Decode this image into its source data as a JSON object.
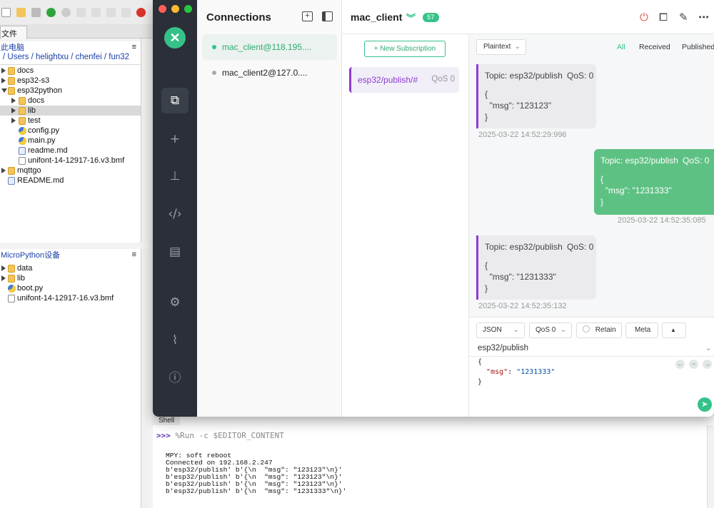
{
  "thonny": {
    "files_tab": "文件",
    "local": {
      "header": "此电脑",
      "menu_icon": "≡",
      "path": "/ Users / helightxu / chenfei / fun32",
      "items": [
        {
          "label": "docs",
          "type": "folder",
          "depth": 0,
          "arrow": "closed"
        },
        {
          "label": "esp32-s3",
          "type": "folder",
          "depth": 0,
          "arrow": "closed"
        },
        {
          "label": "esp32python",
          "type": "folder",
          "depth": 0,
          "arrow": "open"
        },
        {
          "label": "docs",
          "type": "folder",
          "depth": 1,
          "arrow": "closed"
        },
        {
          "label": "lib",
          "type": "folder",
          "depth": 1,
          "arrow": "closed",
          "selected": true
        },
        {
          "label": "test",
          "type": "folder",
          "depth": 1,
          "arrow": "closed"
        },
        {
          "label": "config.py",
          "type": "py",
          "depth": 1
        },
        {
          "label": "main.py",
          "type": "py",
          "depth": 1
        },
        {
          "label": "readme.md",
          "type": "doc",
          "depth": 1
        },
        {
          "label": "unifont-14-12917-16.v3.bmf",
          "type": "file",
          "depth": 1
        },
        {
          "label": "mqttgo",
          "type": "folder",
          "depth": 0,
          "arrow": "closed"
        },
        {
          "label": "README.md",
          "type": "doc",
          "depth": 0
        }
      ]
    },
    "device": {
      "header": "MicroPython设备",
      "menu_icon": "≡",
      "items": [
        {
          "label": "data",
          "type": "folder",
          "arrow": "closed"
        },
        {
          "label": "lib",
          "type": "folder",
          "arrow": "closed"
        },
        {
          "label": "boot.py",
          "type": "py"
        },
        {
          "label": "unifont-14-12917-16.v3.bmf",
          "type": "file"
        }
      ]
    },
    "shell": {
      "tab": "Shell",
      "prompt": ">>>",
      "command": "%Run -c $EDITOR_CONTENT",
      "output": "MPY: soft reboot\nConnected on 192.168.2.247\nb'esp32/publish' b'{\\n  \"msg\": \"123123\"\\n}'\nb'esp32/publish' b'{\\n  \"msg\": \"123123\"\\n}'\nb'esp32/publish' b'{\\n  \"msg\": \"123123\"\\n}'\nb'esp32/publish' b'{\\n  \"msg\": \"1231333\"\\n}'"
    }
  },
  "mqttx": {
    "colors": {
      "accent": "#35c288",
      "sidebar": "#2a2f38",
      "subscription": "#8e3bd1",
      "sent_bubble": "#5dc183"
    },
    "traffic_lights": [
      "#ff5f57",
      "#febc2e",
      "#28c840"
    ],
    "sidebar_icons": [
      "connections-icon",
      "add-icon",
      "topology-icon",
      "script-icon",
      "log-icon",
      "settings-icon",
      "feed-icon",
      "about-icon"
    ],
    "connections": {
      "title": "Connections",
      "items": [
        {
          "label": "mac_client@118.195....",
          "status": "connected"
        },
        {
          "label": "mac_client2@127.0....",
          "status": "disconnected"
        }
      ]
    },
    "header": {
      "name": "mac_client",
      "count": "57"
    },
    "subscriptions": {
      "new_button": "New Subscription",
      "items": [
        {
          "topic": "esp32/publish/#",
          "qos": "QoS 0"
        }
      ]
    },
    "messages": {
      "format": "Plaintext",
      "filters": [
        "All",
        "Received",
        "Published"
      ],
      "items": [
        {
          "direction": "received",
          "topic": "Topic: esp32/publish",
          "qos": "QoS: 0",
          "payload": "{\n  \"msg\": \"123123\"\n}",
          "time": "2025-03-22 14:52:29:996"
        },
        {
          "direction": "sent",
          "topic": "Topic: esp32/publish",
          "qos": "QoS: 0",
          "payload": "{\n  \"msg\": \"1231333\"\n}",
          "time": "2025-03-22 14:52:35:085"
        },
        {
          "direction": "received",
          "topic": "Topic: esp32/publish",
          "qos": "QoS: 0",
          "payload": "{\n  \"msg\": \"1231333\"\n}",
          "time": "2025-03-22 14:52:35:132"
        }
      ]
    },
    "publish": {
      "format": "JSON",
      "qos": "QoS 0",
      "retain": "Retain",
      "meta": "Meta",
      "topic": "esp32/publish",
      "payload_open": "{",
      "payload_key": "\"msg\"",
      "payload_value": "\"1231333\"",
      "payload_close": "}"
    }
  }
}
